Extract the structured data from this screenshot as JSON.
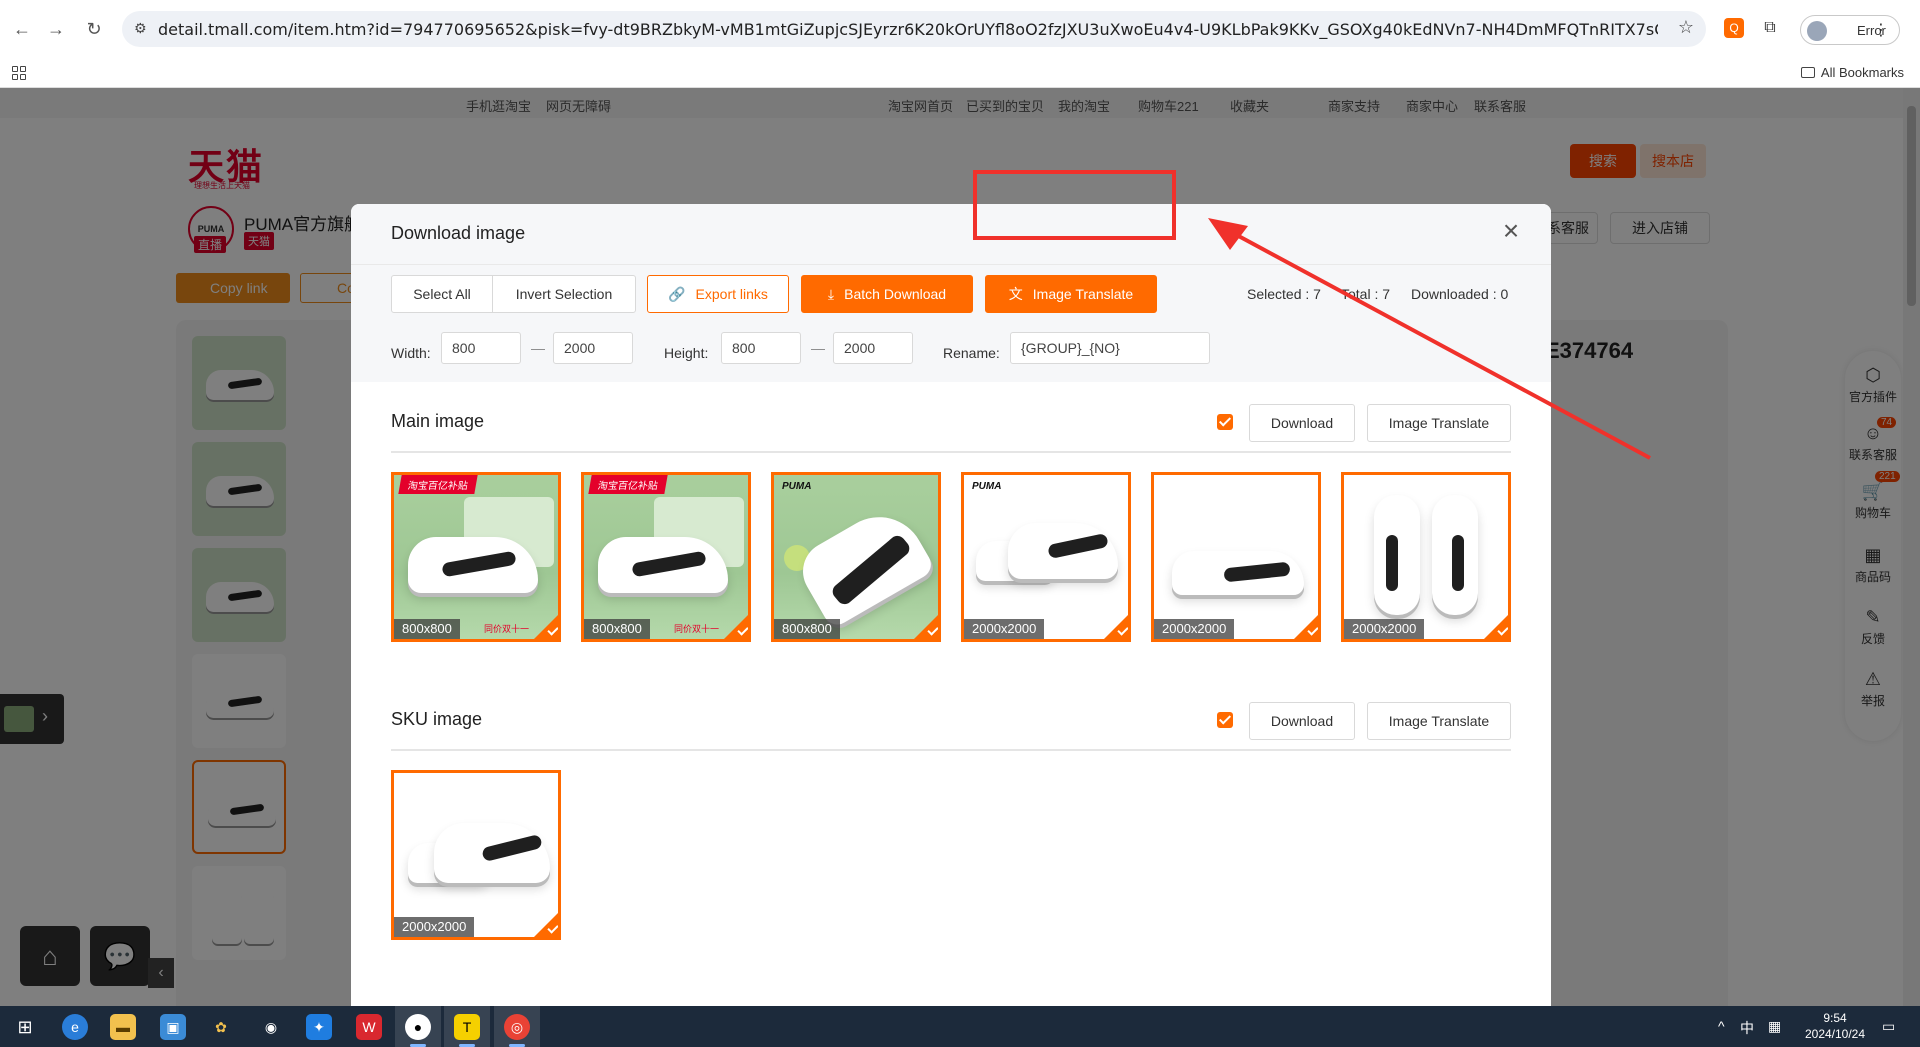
{
  "browser": {
    "url": "detail.tmall.com/item.htm?id=794770695652&pisk=fvy-dt9BRZbkyM-vMB1mtGiZupjcSJEyrzr6K20kOrUYfl8oO2fzJXU3uXwoEu4v4-U9KLbPak9KKv_GSOXg40kEdNVn7-NH4DmMFQTnRITX7sGylOXg4oKoVGqfl8XkWDn9OpalNj...",
    "account_status": "Error",
    "bookmarks_label": "All Bookmarks"
  },
  "page_bg": {
    "topnav": [
      "手机逛淘宝",
      "网页无障碍",
      "淘宝网首页",
      "已买到的宝贝",
      "我的淘宝",
      "购物车221",
      "收藏夹",
      "商家支持",
      "商家中心",
      "联系客服"
    ],
    "logo": "天猫",
    "logo_sub": "理想生活上天猫",
    "search_btn": "搜索",
    "search_store_btn": "搜本店",
    "shop_logo_text": "PUMA",
    "shop_name": "PUMA官方旗舰",
    "shop_tag": "天猫",
    "live_tag": "直播",
    "copy_link": "Copy link",
    "copy2": "Co",
    "contact_service": "系客服",
    "enter_store": "进入店铺",
    "sku_code": "E374764",
    "rail": [
      {
        "icon": "puzzle-icon",
        "glyph": "⬡",
        "label": "官方插件"
      },
      {
        "icon": "service-icon",
        "glyph": "☺",
        "label": "联系客服",
        "badge": "74"
      },
      {
        "icon": "cart-icon",
        "glyph": "🛒",
        "label": "购物车",
        "badge": "221"
      },
      {
        "icon": "qrcode-icon",
        "glyph": "▦",
        "label": "商品码"
      },
      {
        "icon": "feedback-icon",
        "glyph": "✎",
        "label": "反馈"
      },
      {
        "icon": "report-icon",
        "glyph": "⚠",
        "label": "举报"
      }
    ]
  },
  "modal": {
    "title": "Download image",
    "toolbar": {
      "select_all": "Select All",
      "invert_selection": "Invert Selection",
      "export_links": "Export links",
      "batch_download": "Batch Download",
      "image_translate": "Image Translate"
    },
    "counts": {
      "selected": "Selected : 7",
      "total": "Total : 7",
      "downloaded": "Downloaded : 0"
    },
    "filters": {
      "width_label": "Width:",
      "width_min": "800",
      "width_max": "2000",
      "height_label": "Height:",
      "height_min": "800",
      "height_max": "2000",
      "rename_label": "Rename:",
      "rename_value": "{GROUP}_{NO}",
      "dash": "—"
    },
    "main_section": {
      "title": "Main image",
      "download": "Download",
      "translate": "Image Translate",
      "images": [
        {
          "size": "800x800",
          "promo": "淘宝百亿补贴",
          "tag": "同价双十一"
        },
        {
          "size": "800x800",
          "promo": "淘宝百亿补贴",
          "tag": "同价双十一"
        },
        {
          "size": "800x800",
          "brand": "PUMA"
        },
        {
          "size": "2000x2000",
          "brand": "PUMA"
        },
        {
          "size": "2000x2000"
        },
        {
          "size": "2000x2000"
        }
      ]
    },
    "sku_section": {
      "title": "SKU image",
      "download": "Download",
      "translate": "Image Translate",
      "images": [
        {
          "size": "2000x2000"
        }
      ]
    }
  },
  "taskbar": {
    "tray_lang": "中",
    "clock_time": "9:54",
    "clock_date": "2024/10/24"
  },
  "colors": {
    "accent": "#ff6a00",
    "annotation": "#f0312b",
    "tmall_red": "#e4002b"
  }
}
